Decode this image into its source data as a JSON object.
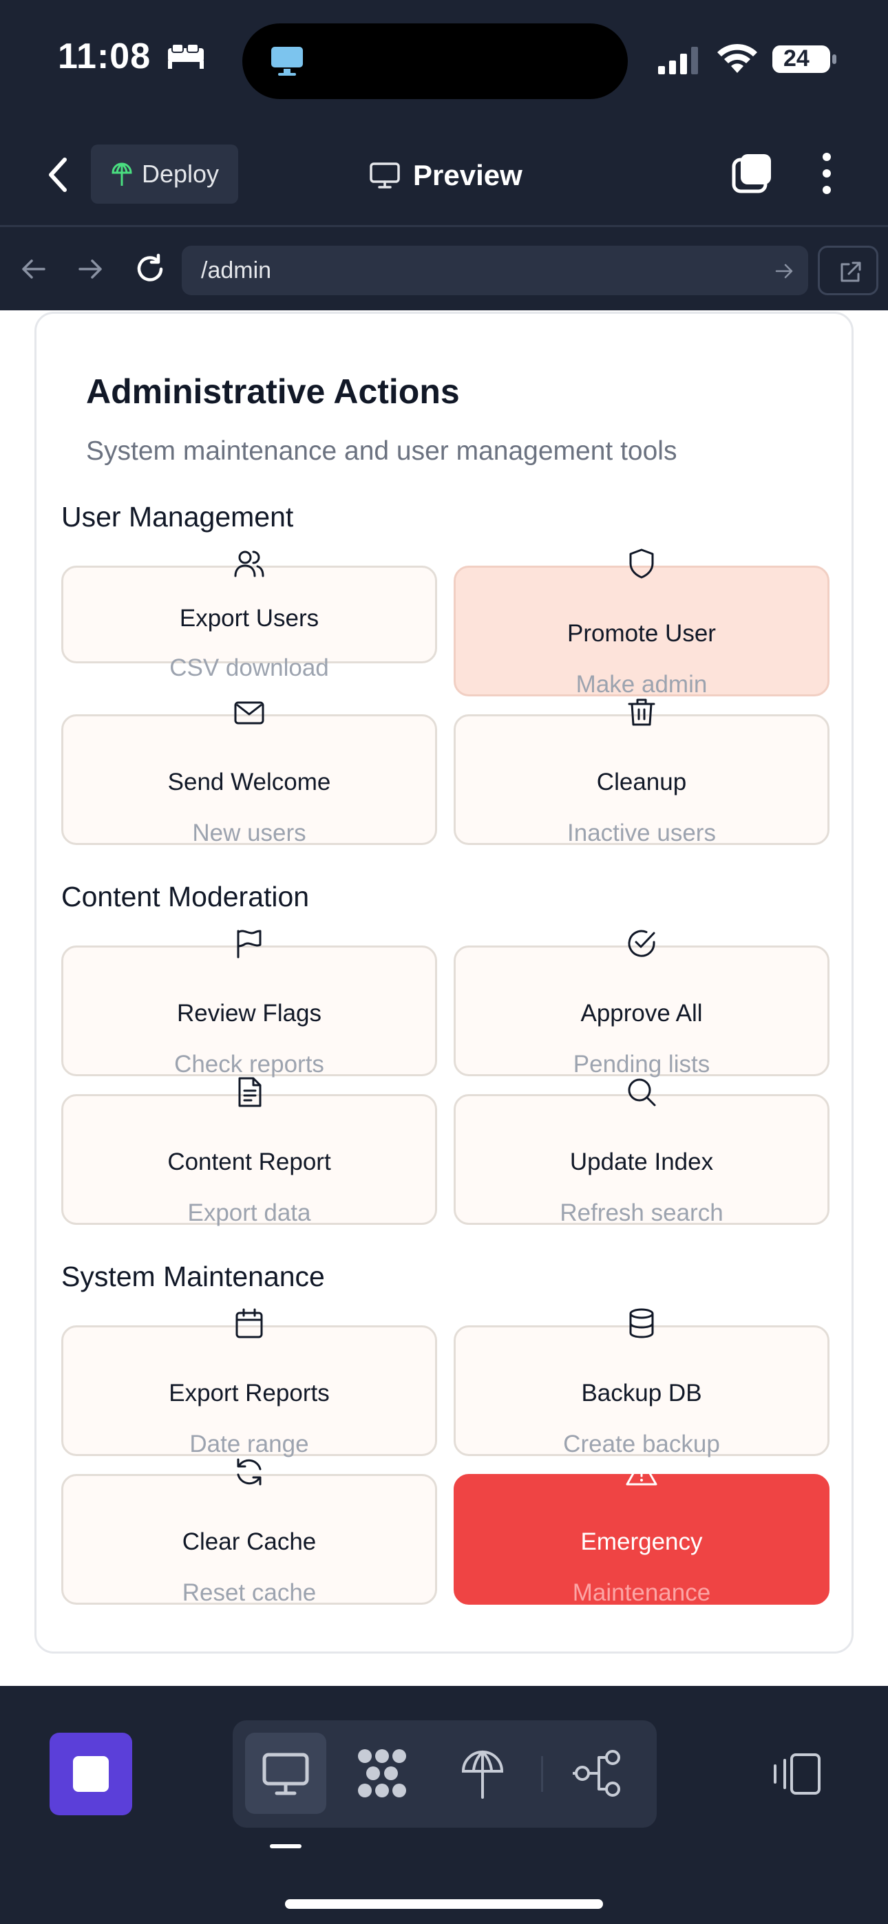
{
  "status_bar": {
    "time": "11:08",
    "battery_level": "24"
  },
  "header": {
    "deploy_label": "Deploy",
    "preview_label": "Preview"
  },
  "url_bar": {
    "url": "/admin"
  },
  "card": {
    "title": "Administrative Actions",
    "subtitle": "System maintenance and user management tools"
  },
  "sections": [
    {
      "title": "User Management",
      "actions": [
        {
          "label": "Export Users",
          "sub": "CSV download",
          "icon": "users-icon"
        },
        {
          "label": "Promote User",
          "sub": "Make admin",
          "icon": "shield-icon"
        },
        {
          "label": "Send Welcome",
          "sub": "New users",
          "icon": "mail-icon"
        },
        {
          "label": "Cleanup",
          "sub": "Inactive users",
          "icon": "trash-icon"
        }
      ]
    },
    {
      "title": "Content Moderation",
      "actions": [
        {
          "label": "Review Flags",
          "sub": "Check reports",
          "icon": "flag-icon"
        },
        {
          "label": "Approve All",
          "sub": "Pending lists",
          "icon": "check-circle-icon"
        },
        {
          "label": "Content Report",
          "sub": "Export data",
          "icon": "document-icon"
        },
        {
          "label": "Update Index",
          "sub": "Refresh search",
          "icon": "search-icon"
        }
      ]
    },
    {
      "title": "System Maintenance",
      "actions": [
        {
          "label": "Export Reports",
          "sub": "Date range",
          "icon": "calendar-icon"
        },
        {
          "label": "Backup DB",
          "sub": "Create backup",
          "icon": "database-icon"
        },
        {
          "label": "Clear Cache",
          "sub": "Reset cache",
          "icon": "refresh-icon"
        },
        {
          "label": "Emergency",
          "sub": "Maintenance",
          "icon": "warning-icon"
        }
      ]
    }
  ],
  "colors": {
    "app_background": "#1c2333",
    "promote_highlight": "#fde3da",
    "emergency": "#ef4444",
    "stop_button": "#5b3fd9"
  }
}
